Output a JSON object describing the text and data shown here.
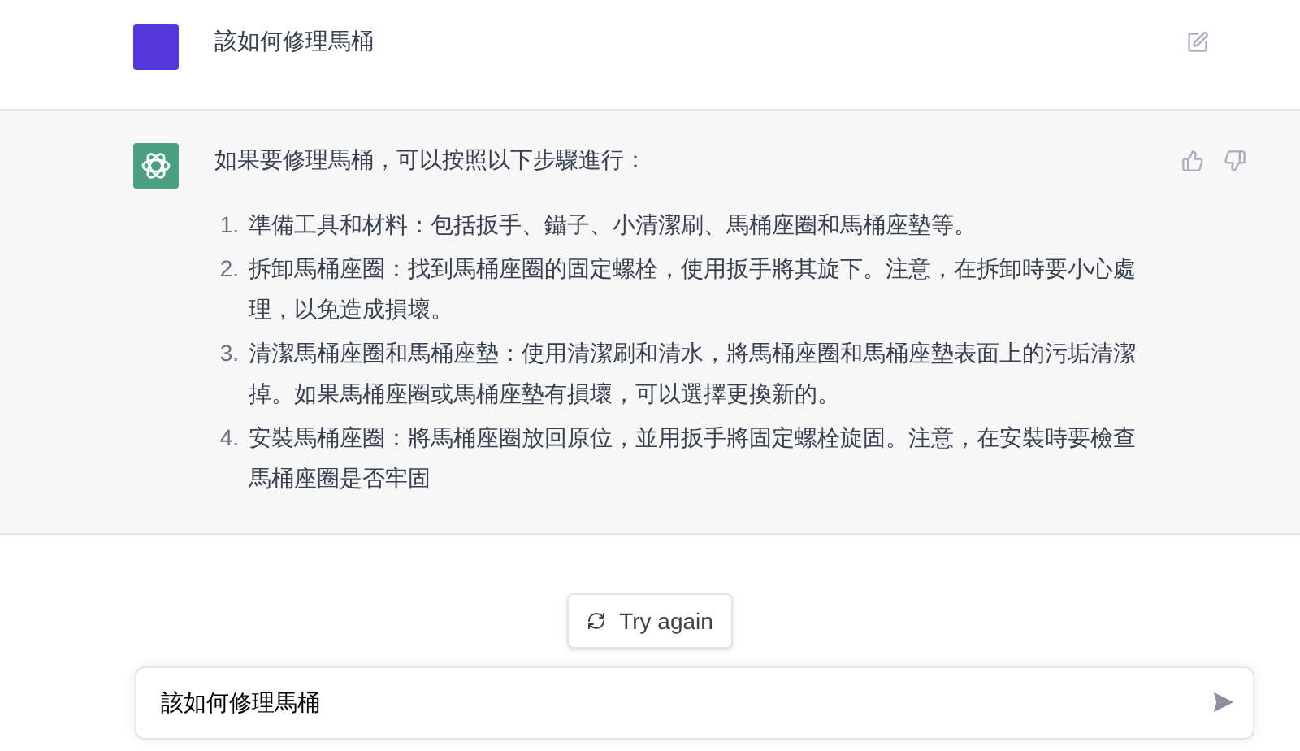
{
  "user_message": {
    "text": "該如何修理馬桶"
  },
  "assistant_message": {
    "intro": "如果要修理馬桶，可以按照以下步驟進行：",
    "steps": [
      {
        "marker": "1.",
        "text": "準備工具和材料：包括扳手、鑷子、小清潔刷、馬桶座圈和馬桶座墊等。"
      },
      {
        "marker": "2.",
        "text": "拆卸馬桶座圈：找到馬桶座圈的固定螺栓，使用扳手將其旋下。注意，在拆卸時要小心處理，以免造成損壞。"
      },
      {
        "marker": "3.",
        "text": "清潔馬桶座圈和馬桶座墊：使用清潔刷和清水，將馬桶座圈和馬桶座墊表面上的污垢清潔掉。如果馬桶座圈或馬桶座墊有損壞，可以選擇更換新的。"
      },
      {
        "marker": "4.",
        "text": "安裝馬桶座圈：將馬桶座圈放回原位，並用扳手將固定螺栓旋固。注意，在安裝時要檢查馬桶座圈是否牢固"
      }
    ]
  },
  "retry_button": {
    "label": "Try again"
  },
  "composer": {
    "value": "該如何修理馬桶"
  }
}
